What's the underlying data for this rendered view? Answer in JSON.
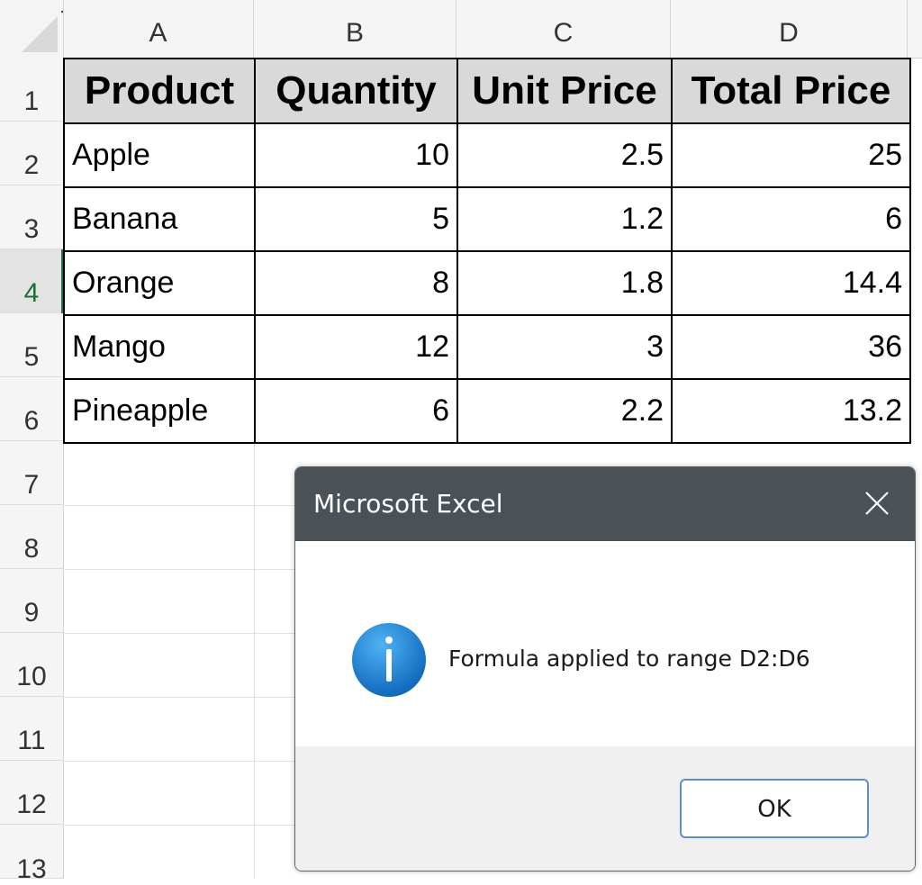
{
  "app": {
    "column_headers": [
      "A",
      "B",
      "C",
      "D"
    ],
    "row_headers": [
      "1",
      "2",
      "3",
      "4",
      "5",
      "6",
      "7",
      "8",
      "9",
      "10",
      "11",
      "12",
      "13"
    ],
    "active_row": "4"
  },
  "table": {
    "headers": [
      "Product",
      "Quantity",
      "Unit Price",
      "Total Price"
    ],
    "rows": [
      [
        "Apple",
        "10",
        "2.5",
        "25"
      ],
      [
        "Banana",
        "5",
        "1.2",
        "6"
      ],
      [
        "Orange",
        "8",
        "1.8",
        "14.4"
      ],
      [
        "Mango",
        "12",
        "3",
        "36"
      ],
      [
        "Pineapple",
        "6",
        "2.2",
        "13.2"
      ]
    ]
  },
  "dialog": {
    "title": "Microsoft Excel",
    "message": "Formula applied to range D2:D6",
    "ok_label": "OK",
    "icon": "info-icon",
    "close_icon": "close-icon"
  },
  "colors": {
    "title_bar": "#4a5157",
    "header_fill": "#d9d9d9",
    "icon_blue": "#1a7fd4",
    "button_border": "#5b8fcf",
    "active_row_marker": "#1e7145"
  }
}
